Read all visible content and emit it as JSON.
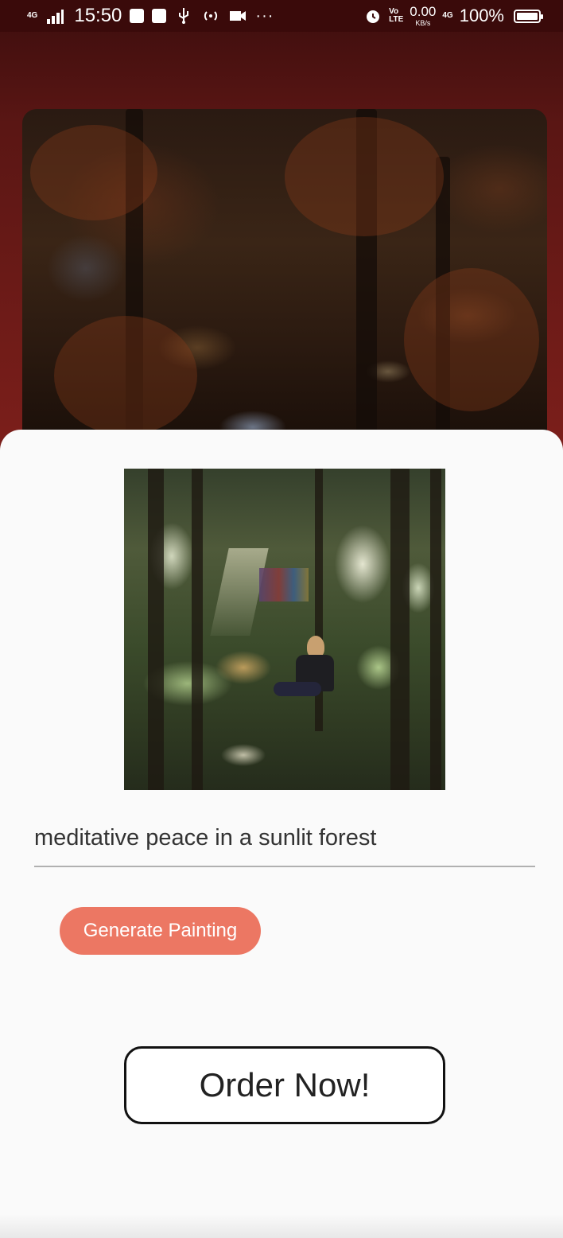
{
  "status_bar": {
    "network_type": "4G",
    "time": "15:50",
    "volte_top": "Vo",
    "volte_bottom": "LTE",
    "net_speed": "0.00",
    "net_speed_unit": "KB/s",
    "network_type_2": "4G",
    "battery_percent_text": "100%",
    "battery_level": 1.0,
    "more_indicator": "···"
  },
  "header_painting": {
    "icon": "painting-image"
  },
  "preview": {
    "icon": "generated-forest-image"
  },
  "prompt": {
    "value": "meditative peace in a sunlit forest",
    "placeholder": ""
  },
  "actions": {
    "generate_label": "Generate Painting",
    "order_label": "Order Now!"
  },
  "colors": {
    "accent": "#ec7763",
    "background_top": "#7a1e1a",
    "sheet": "#fafafa"
  }
}
